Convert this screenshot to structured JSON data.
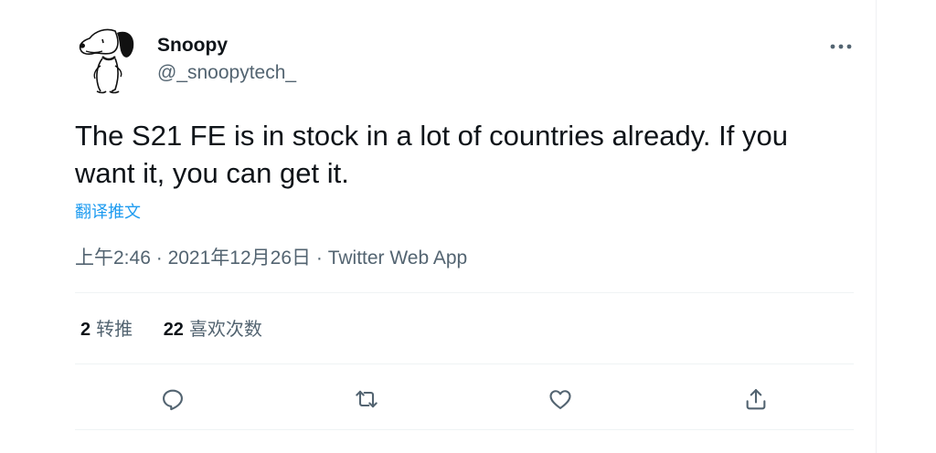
{
  "tweet": {
    "author_name": "Snoopy",
    "author_handle": "@_snoopytech_",
    "text": "The S21 FE is in stock in a lot of countries already. If you want it, you can get it.",
    "translate_label": "翻译推文",
    "time": "上午2:46",
    "separator": "·",
    "date": "2021年12月26日",
    "source": "Twitter Web App"
  },
  "stats": {
    "retweets_count": "2",
    "retweets_label": "转推",
    "likes_count": "22",
    "likes_label": "喜欢次数"
  },
  "icons": {
    "more": "more-horizontal-icon",
    "reply": "reply-icon",
    "retweet": "retweet-icon",
    "like": "heart-icon",
    "share": "share-icon"
  },
  "colors": {
    "link": "#1d9bf0",
    "secondary_text": "#536471",
    "primary_text": "#0f1419",
    "icon": "#536471"
  }
}
